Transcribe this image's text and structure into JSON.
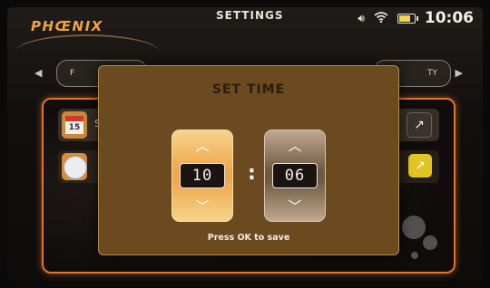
{
  "status_bar": {
    "brand": "PHŒNIX",
    "title": "SETTINGS",
    "time": "10:06",
    "icons": [
      "speaker-icon",
      "wifi-icon",
      "battery-icon"
    ]
  },
  "tabs": {
    "left_visible": "F",
    "right_visible": "TY"
  },
  "settings_rows": [
    {
      "icon": "calendar-icon",
      "calendar_day": "15",
      "label": "S",
      "action_icon": "edit-icon"
    },
    {
      "icon": "clock-icon",
      "label": "",
      "action_icon": "edit-icon"
    }
  ],
  "dialog": {
    "title": "SET TIME",
    "hour": "10",
    "minute": "06",
    "separator": ":",
    "hint": "Press OK to save"
  },
  "colors": {
    "accent_orange": "#e0752a",
    "dialog_bg": "#6b4a20",
    "active_spinner": "#f0a54a",
    "edit_yellow": "#e3c521"
  }
}
